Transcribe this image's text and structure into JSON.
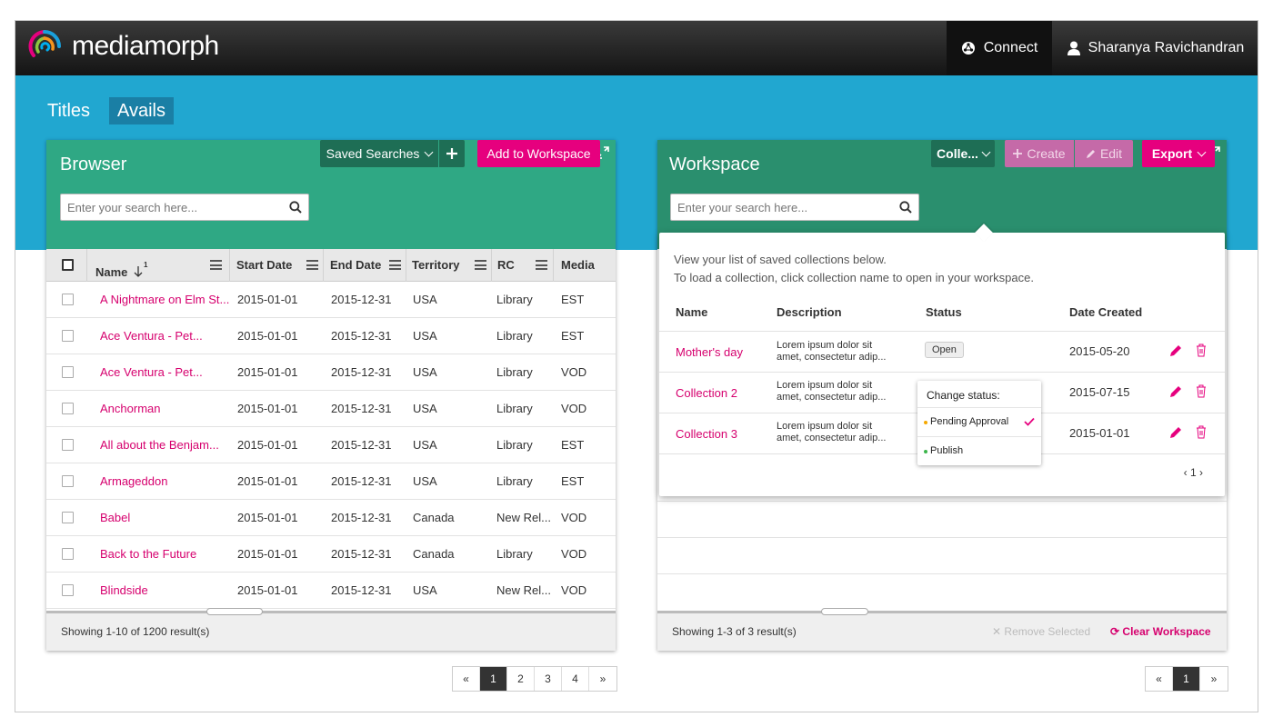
{
  "app": {
    "name": "mediamorph",
    "connect": "Connect",
    "user": "Sharanya Ravichandran"
  },
  "nav": {
    "titles": "Titles",
    "avails": "Avails"
  },
  "colors": {
    "accent": "#e6007e",
    "band": "#21a7d0",
    "browser_head": "#2fa884",
    "workspace_head": "#2a8f6e"
  },
  "browser": {
    "title": "Browser",
    "search_placeholder": "Enter your search here...",
    "saved_searches": "Saved Searches",
    "add_to_workspace": "Add to Workspace",
    "columns": {
      "name": "Name",
      "sort_order": "1",
      "start": "Start Date",
      "end": "End Date",
      "territory": "Territory",
      "rc": "RC",
      "media": "Media"
    },
    "rows": [
      {
        "name": "A Nightmare on Elm St...",
        "start": "2015-01-01",
        "end": "2015-12-31",
        "territory": "USA",
        "rc": "Library",
        "media": "EST"
      },
      {
        "name": "Ace Ventura - Pet...",
        "start": "2015-01-01",
        "end": "2015-12-31",
        "territory": "USA",
        "rc": "Library",
        "media": "EST"
      },
      {
        "name": "Ace Ventura - Pet...",
        "start": "2015-01-01",
        "end": "2015-12-31",
        "territory": "USA",
        "rc": "Library",
        "media": "VOD"
      },
      {
        "name": "Anchorman",
        "start": "2015-01-01",
        "end": "2015-12-31",
        "territory": "USA",
        "rc": "Library",
        "media": "VOD"
      },
      {
        "name": "All about the Benjam...",
        "start": "2015-01-01",
        "end": "2015-12-31",
        "territory": "USA",
        "rc": "Library",
        "media": "EST"
      },
      {
        "name": "Armageddon",
        "start": "2015-01-01",
        "end": "2015-12-31",
        "territory": "USA",
        "rc": "Library",
        "media": "EST"
      },
      {
        "name": "Babel",
        "start": "2015-01-01",
        "end": "2015-12-31",
        "territory": "Canada",
        "rc": "New Rel...",
        "media": "VOD"
      },
      {
        "name": "Back to the Future",
        "start": "2015-01-01",
        "end": "2015-12-31",
        "territory": "Canada",
        "rc": "Library",
        "media": "VOD"
      },
      {
        "name": "Blindside",
        "start": "2015-01-01",
        "end": "2015-12-31",
        "territory": "USA",
        "rc": "New Rel...",
        "media": "VOD"
      }
    ],
    "footer": "Showing 1-10 of 1200 result(s)",
    "pager": {
      "prev": "«",
      "pages": [
        "1",
        "2",
        "3",
        "4"
      ],
      "next": "»"
    }
  },
  "workspace": {
    "title": "Workspace",
    "search_placeholder": "Enter your search here...",
    "collections_btn": "Colle...",
    "create": "Create",
    "edit": "Edit",
    "export": "Export",
    "footer": "Showing 1-3 of 3 result(s)",
    "remove_selected": "Remove Selected",
    "clear_workspace": "Clear Workspace",
    "pager": {
      "prev": "«",
      "pages": [
        "1"
      ],
      "next": "»"
    }
  },
  "collections": {
    "intro1": "View your list of saved collections below.",
    "intro2": "To load a collection, click collection name to open in your workspace.",
    "columns": {
      "name": "Name",
      "description": "Description",
      "status": "Status",
      "date": "Date Created"
    },
    "rows": [
      {
        "name": "Mother's day",
        "desc1": "Lorem ipsum dolor sit",
        "desc2": "amet, consectetur adip...",
        "status": "Open",
        "date": "2015-05-20"
      },
      {
        "name": "Collection 2",
        "desc1": "Lorem ipsum dolor sit",
        "desc2": "amet, consectetur adip...",
        "status": "",
        "date": "2015-07-15"
      },
      {
        "name": "Collection 3",
        "desc1": "Lorem ipsum dolor sit",
        "desc2": "amet, consectetur adip...",
        "status": "",
        "date": "2015-01-01"
      }
    ],
    "pager": "1",
    "status_menu": {
      "title": "Change status:",
      "pending": "Pending Approval",
      "publish": "Publish"
    }
  }
}
